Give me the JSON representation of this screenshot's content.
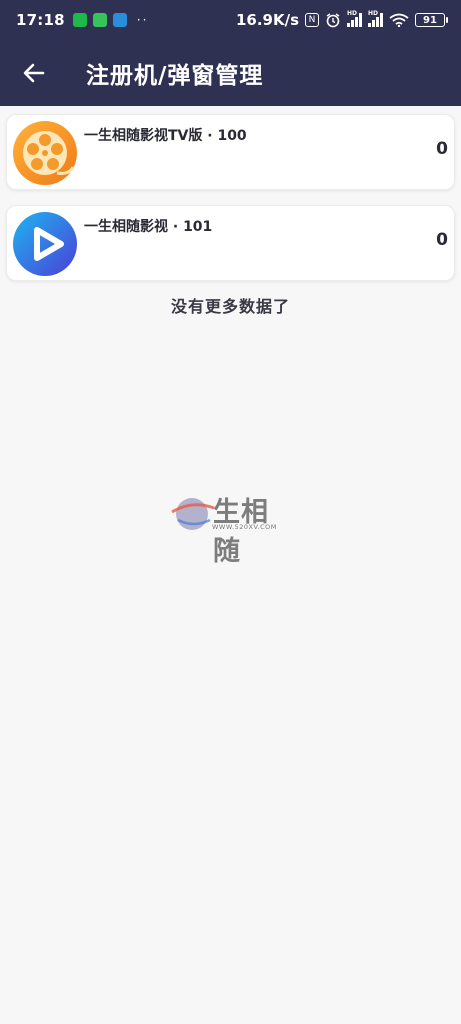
{
  "status_bar": {
    "time": "17:18",
    "overflow_dots": "··",
    "net_speed": "16.9K/s",
    "nfc_label": "N",
    "hd_label": "HD",
    "battery": "91"
  },
  "header": {
    "title": "注册机/弹窗管理"
  },
  "apps": [
    {
      "name": "一生相随影视TV版 · 100",
      "count": "0",
      "icon": "film-reel-icon"
    },
    {
      "name": "一生相随影视 · 101",
      "count": "0",
      "icon": "play-icon"
    }
  ],
  "footer": {
    "no_more": "没有更多数据了"
  },
  "watermark": {
    "text": "生相随",
    "url": "WWW.520XV.COM"
  },
  "colors": {
    "header_bg": "#2f3152",
    "page_bg": "#f7f7f8",
    "card_bg": "#ffffff"
  }
}
